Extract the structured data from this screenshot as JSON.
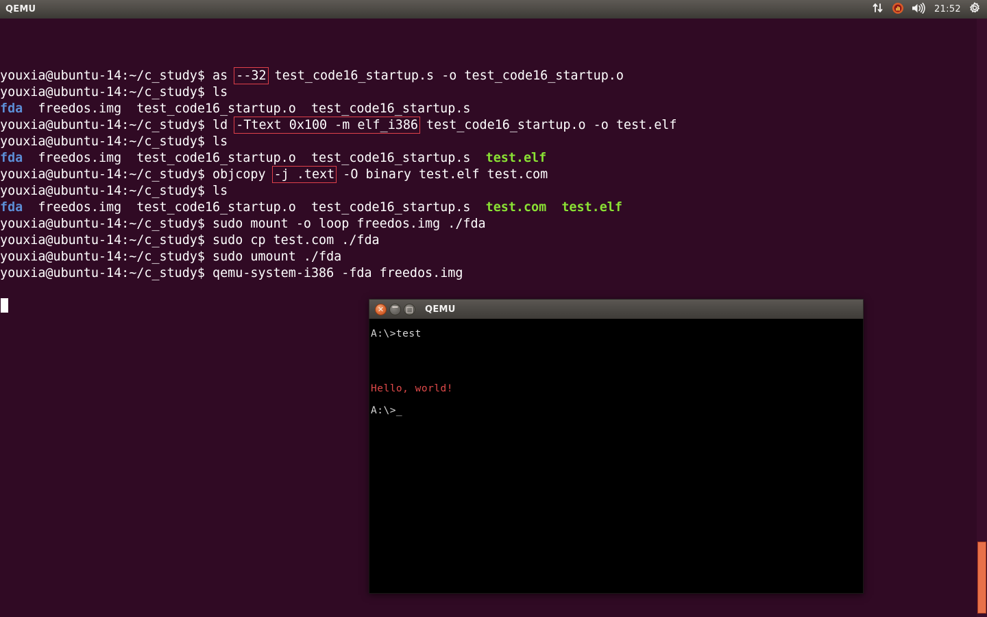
{
  "top_panel": {
    "title": "QEMU",
    "clock": "21:52",
    "icons": [
      {
        "name": "network-indicator-icon",
        "glyph": "⇅"
      },
      {
        "name": "app-indicator-icon",
        "glyph": "◉"
      },
      {
        "name": "volume-indicator-icon",
        "glyph": "🔊"
      },
      {
        "name": "system-settings-gear-icon",
        "glyph": "⚙"
      }
    ]
  },
  "terminal": {
    "prompt": "youxia@ubuntu-14:~/c_study$ ",
    "background_color": "#300a24",
    "text_color": "#ffffff",
    "dir_color": "#5c8ed6",
    "exec_color": "#8ae234",
    "highlight_color": "#e0414a",
    "lines": [
      {
        "type": "command",
        "segments": [
          {
            "text": "youxia@ubuntu-14:~/c_study$ ",
            "style": "white"
          },
          {
            "text": "as ",
            "style": "white"
          },
          {
            "text": "--32",
            "style": "white",
            "highlight": true
          },
          {
            "text": " test_code16_startup.s -o test_code16_startup.o",
            "style": "white"
          }
        ]
      },
      {
        "type": "command",
        "segments": [
          {
            "text": "youxia@ubuntu-14:~/c_study$ ",
            "style": "white"
          },
          {
            "text": "ls",
            "style": "white"
          }
        ]
      },
      {
        "type": "output",
        "segments": [
          {
            "text": "fda",
            "style": "dir"
          },
          {
            "text": "  freedos.img  test_code16_startup.o  test_code16_startup.s",
            "style": "white"
          }
        ]
      },
      {
        "type": "command",
        "segments": [
          {
            "text": "youxia@ubuntu-14:~/c_study$ ",
            "style": "white"
          },
          {
            "text": "ld ",
            "style": "white"
          },
          {
            "text": "-Ttext 0x100 -m elf_i386",
            "style": "white",
            "highlight": true
          },
          {
            "text": " test_code16_startup.o -o test.elf",
            "style": "white"
          }
        ]
      },
      {
        "type": "command",
        "segments": [
          {
            "text": "youxia@ubuntu-14:~/c_study$ ",
            "style": "white"
          },
          {
            "text": "ls",
            "style": "white"
          }
        ]
      },
      {
        "type": "output",
        "segments": [
          {
            "text": "fda",
            "style": "dir"
          },
          {
            "text": "  freedos.img  test_code16_startup.o  test_code16_startup.s  ",
            "style": "white"
          },
          {
            "text": "test.elf",
            "style": "exec"
          }
        ]
      },
      {
        "type": "command",
        "segments": [
          {
            "text": "youxia@ubuntu-14:~/c_study$ ",
            "style": "white"
          },
          {
            "text": "objcopy ",
            "style": "white"
          },
          {
            "text": "-j .text",
            "style": "white",
            "highlight": true
          },
          {
            "text": " -O binary test.elf test.com",
            "style": "white"
          }
        ]
      },
      {
        "type": "command",
        "segments": [
          {
            "text": "youxia@ubuntu-14:~/c_study$ ",
            "style": "white"
          },
          {
            "text": "ls",
            "style": "white"
          }
        ]
      },
      {
        "type": "output",
        "segments": [
          {
            "text": "fda",
            "style": "dir"
          },
          {
            "text": "  freedos.img  test_code16_startup.o  test_code16_startup.s  ",
            "style": "white"
          },
          {
            "text": "test.com",
            "style": "exec"
          },
          {
            "text": "  ",
            "style": "white"
          },
          {
            "text": "test.elf",
            "style": "exec"
          }
        ]
      },
      {
        "type": "command",
        "segments": [
          {
            "text": "youxia@ubuntu-14:~/c_study$ ",
            "style": "white"
          },
          {
            "text": "sudo mount -o loop freedos.img ./fda",
            "style": "white"
          }
        ]
      },
      {
        "type": "command",
        "segments": [
          {
            "text": "youxia@ubuntu-14:~/c_study$ ",
            "style": "white"
          },
          {
            "text": "sudo cp test.com ./fda",
            "style": "white"
          }
        ]
      },
      {
        "type": "command",
        "segments": [
          {
            "text": "youxia@ubuntu-14:~/c_study$ ",
            "style": "white"
          },
          {
            "text": "sudo umount ./fda",
            "style": "white"
          }
        ]
      },
      {
        "type": "command",
        "segments": [
          {
            "text": "youxia@ubuntu-14:~/c_study$ ",
            "style": "white"
          },
          {
            "text": "qemu-system-i386 -fda freedos.img",
            "style": "white"
          }
        ]
      }
    ]
  },
  "qemu_window": {
    "title": "QEMU",
    "controls": [
      {
        "name": "close-button",
        "glyph": "✕"
      },
      {
        "name": "minimize-button",
        "glyph": "−"
      },
      {
        "name": "maximize-button",
        "glyph": "□"
      }
    ],
    "screen": {
      "background_color": "#000000",
      "lines": [
        {
          "text": "A:\\>test",
          "style": "white"
        },
        {
          "text": "",
          "style": "blank"
        },
        {
          "text": "",
          "style": "blank"
        },
        {
          "text": "",
          "style": "blank"
        },
        {
          "text": "",
          "style": "blank"
        },
        {
          "text": "Hello, world!",
          "style": "red"
        },
        {
          "text": "",
          "style": "blank"
        },
        {
          "text": "A:\\>_",
          "style": "white"
        }
      ]
    }
  }
}
